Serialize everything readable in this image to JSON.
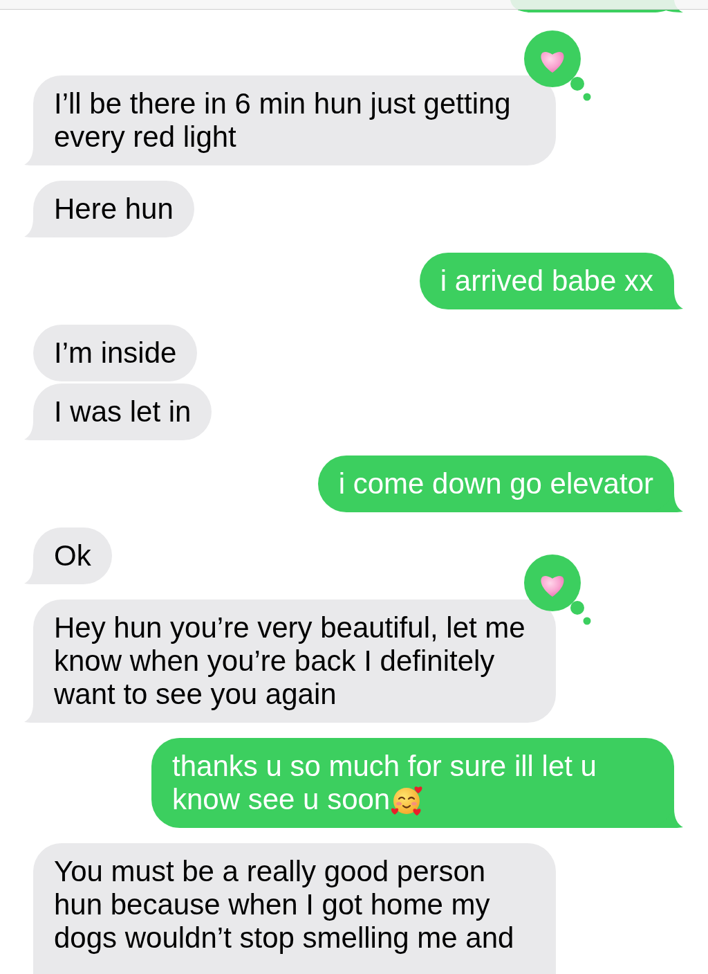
{
  "cut_off_message": {
    "kind": "sent"
  },
  "messages": [
    {
      "kind": "received",
      "text": "I’ll be there in 6 min hun just getting every red light",
      "tapback": true,
      "trailing_emoji": false
    },
    {
      "kind": "received",
      "text": "Here hun",
      "tapback": false,
      "trailing_emoji": false
    },
    {
      "kind": "sent",
      "text": "i arrived babe xx",
      "tapback": false,
      "trailing_emoji": false
    },
    {
      "kind": "received",
      "text": "I’m inside",
      "tapback": false,
      "trailing_emoji": false
    },
    {
      "kind": "received",
      "text": "I was let in",
      "tapback": false,
      "trailing_emoji": false
    },
    {
      "kind": "sent",
      "text": "i come down go elevator",
      "tapback": false,
      "trailing_emoji": false
    },
    {
      "kind": "received",
      "text": "Ok",
      "tapback": false,
      "trailing_emoji": false
    },
    {
      "kind": "received",
      "text": "Hey hun you’re very beautiful, let me know when you’re back I definitely want to see you again",
      "tapback": true,
      "trailing_emoji": false
    },
    {
      "kind": "sent",
      "text": "thanks u so much for sure ill let u know see u soon",
      "tapback": false,
      "trailing_emoji": true
    },
    {
      "kind": "received",
      "text": "You must be a really good person hun because when I got home my dogs wouldn’t stop smelling me and",
      "tapback": false,
      "trailing_emoji": false
    }
  ]
}
